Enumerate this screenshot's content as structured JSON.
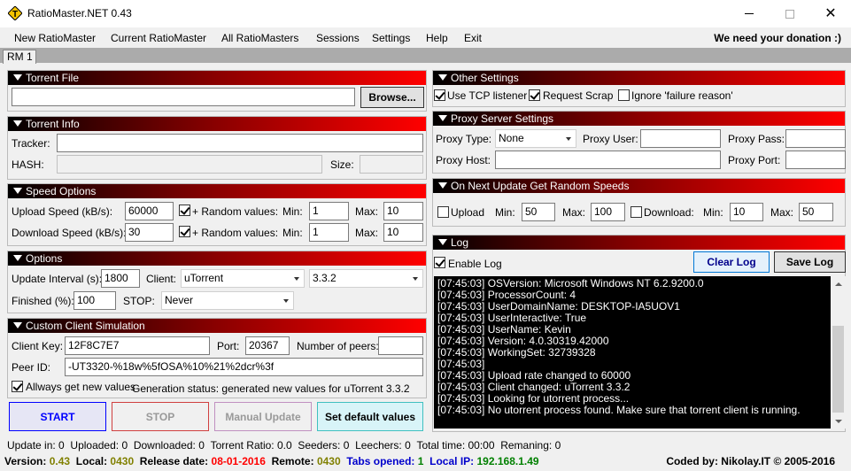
{
  "window": {
    "title": "RatioMaster.NET 0.43"
  },
  "menu": {
    "items": [
      "New RatioMaster",
      "Current RatioMaster",
      "All RatioMasters",
      "Sessions",
      "Settings",
      "Help",
      "Exit"
    ],
    "donation": "We need your donation :)"
  },
  "tabs": [
    "RM 1"
  ],
  "torrent_file": {
    "header": "Torrent File",
    "path": "",
    "browse_label": "Browse..."
  },
  "torrent_info": {
    "header": "Torrent Info",
    "tracker_label": "Tracker:",
    "tracker": "",
    "hash_label": "HASH:",
    "hash": "",
    "size_label": "Size:",
    "size": ""
  },
  "speed": {
    "header": "Speed Options",
    "upload_label": "Upload Speed (kB/s):",
    "upload": "60000",
    "download_label": "Download Speed (kB/s):",
    "download": "30",
    "random_label": "+ Random values:",
    "min_label": "Min:",
    "max_label": "Max:",
    "up_min": "1",
    "up_max": "10",
    "down_min": "1",
    "down_max": "10"
  },
  "options": {
    "header": "Options",
    "interval_label": "Update Interval (s):",
    "interval": "1800",
    "client_label": "Client:",
    "client": "uTorrent",
    "version": "3.3.2",
    "finished_label": "Finished (%):",
    "finished": "100",
    "stop_label": "STOP:",
    "stop": "Never"
  },
  "custom": {
    "header": "Custom Client Simulation",
    "key_label": "Client Key:",
    "key": "12F8C7E7",
    "port_label": "Port:",
    "port": "20367",
    "peers_label": "Number of peers:",
    "peers": "",
    "peerid_label": "Peer ID:",
    "peerid": "-UT3320-%18w%5fOSA%10%21%2dcr%3f",
    "always_label": "Allways get new values",
    "gen_status": "Generation status: generated new values for uTorrent 3.3.2"
  },
  "buttons": {
    "start": "START",
    "stop": "STOP",
    "manual": "Manual Update",
    "default": "Set default values"
  },
  "other": {
    "header": "Other Settings",
    "tcp": "Use TCP listener",
    "scrap": "Request Scrap",
    "ignore": "Ignore 'failure reason'"
  },
  "proxy": {
    "header": "Proxy Server Settings",
    "type_label": "Proxy Type:",
    "type": "None",
    "user_label": "Proxy User:",
    "user": "",
    "pass_label": "Proxy Pass:",
    "pass": "",
    "host_label": "Proxy Host:",
    "host": "",
    "port_label": "Proxy Port:",
    "port": ""
  },
  "random": {
    "header": "On Next Update Get Random Speeds",
    "upload_label": "Upload",
    "download_label": "Download:",
    "min_label": "Min:",
    "max_label": "Max:",
    "up_min": "50",
    "up_max": "100",
    "down_min": "10",
    "down_max": "50"
  },
  "log": {
    "header": "Log",
    "enable_label": "Enable Log",
    "clear_label": "Clear Log",
    "save_label": "Save Log",
    "lines": [
      "[07:45:03] OSVersion: Microsoft Windows NT 6.2.9200.0",
      "[07:45:03] ProcessorCount: 4",
      "[07:45:03] UserDomainName: DESKTOP-IA5UOV1",
      "[07:45:03] UserInteractive: True",
      "[07:45:03] UserName: Kevin",
      "[07:45:03] Version: 4.0.30319.42000",
      "[07:45:03] WorkingSet: 32739328",
      "[07:45:03]",
      "[07:45:03] Upload rate changed to 60000",
      "[07:45:03] Client changed: uTorrent 3.3.2",
      "[07:45:03] Looking for utorrent process...",
      "[07:45:03] No utorrent process found. Make sure that torrent client is running."
    ]
  },
  "status": {
    "update_in": "Update in:",
    "update_in_v": "0",
    "uploaded": "Uploaded:",
    "uploaded_v": "0",
    "downloaded": "Downloaded:",
    "downloaded_v": "0",
    "ratio": "Torrent Ratio:",
    "ratio_v": "0.0",
    "seeders": "Seeders:",
    "seeders_v": "0",
    "leechers": "Leechers:",
    "leechers_v": "0",
    "total_time": "Total time:",
    "total_time_v": "00:00",
    "remaining": "Remaning:",
    "remaining_v": "0"
  },
  "footer": {
    "version": "Version:",
    "version_v": "0.43",
    "local": "Local:",
    "local_v": "0430",
    "release": "Release date:",
    "release_v": "08-01-2016",
    "remote": "Remote:",
    "remote_v": "0430",
    "tabs": "Tabs opened:",
    "tabs_v": "1",
    "ip": "Local IP:",
    "ip_v": "192.168.1.49",
    "coded": "Coded by: Nikolay.IT © 2005-2016"
  },
  "colors": {
    "accent_red": "#ff0000",
    "version_green": "#808000",
    "release_red": "#ff0000",
    "tabs_blue": "#0000cc",
    "ip_green": "#008000",
    "start_blue": "#0000ff"
  }
}
